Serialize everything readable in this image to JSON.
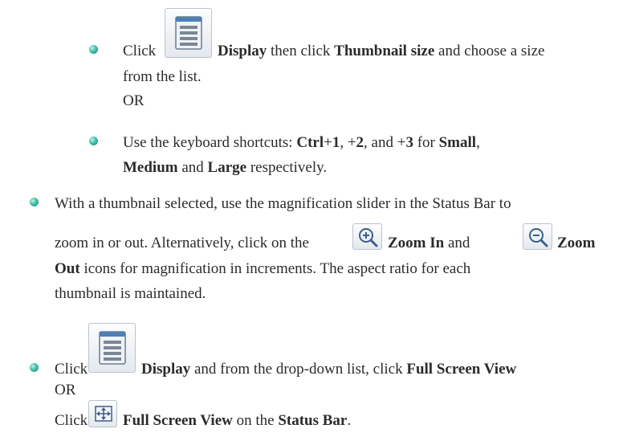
{
  "colors": {
    "bullet": "#2aa59a",
    "text": "#2b2b2b"
  },
  "icons": [
    "display-icon",
    "zoom-in-icon",
    "zoom-out-icon",
    "full-screen-icon"
  ],
  "block1": {
    "click": "Click",
    "display": "Display",
    "then_click": " then click ",
    "thumbnail_size": "Thumbnail size",
    "choose": " and choose a size",
    "from_list": "from the list.",
    "or": "OR"
  },
  "block2": {
    "use": "Use the keyboard shortcuts: ",
    "ctrl": "Ctrl",
    "plus1": "+",
    "one": "1",
    "comma1": ", +",
    "two": "2",
    "and": ", and +",
    "three": "3",
    "for": " for ",
    "small": "Small",
    "comma2": ",",
    "medium": "Medium",
    "and2": " and ",
    "large": "Large",
    "respectively": " respectively."
  },
  "block3": {
    "line1": "With a thumbnail selected, use the magnification slider in the Status Bar to",
    "line2a": "zoom in or out. Alternatively, click on the ",
    "zoom_in": "Zoom In",
    "and": " and ",
    "zoom": "Zoom",
    "out": "Out",
    "line3": " icons for magnification in increments. The aspect ratio for each",
    "line4": "thumbnail is maintained."
  },
  "block4": {
    "click": "Click",
    "display": "Display",
    "from_list": " and from the drop-down list, click ",
    "full_screen_view": "Full Screen View",
    "or": "OR",
    "click2": "Click",
    "full_screen_view2": "Full Screen View",
    "on_the": " on the ",
    "status_bar": "Status Bar",
    "period": "."
  }
}
